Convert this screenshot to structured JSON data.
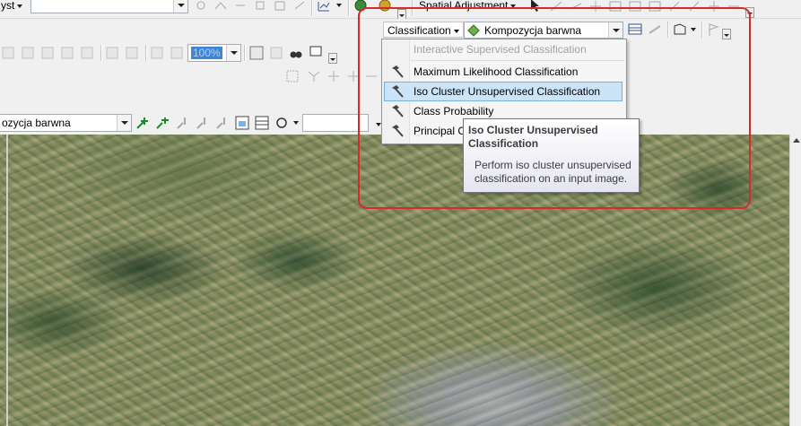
{
  "toolbar_top": {
    "left_combo": "yst",
    "spatial_adjustment_label": "Spatial Adjustment"
  },
  "toolbar_mid": {
    "zoom_value": "100%"
  },
  "toolbar_layer": {
    "layer_combo": "ozycja barwna"
  },
  "classification_toolbar": {
    "menu_label": "Classification",
    "layer_combo": "Kompozycja barwna"
  },
  "menu": {
    "items": [
      {
        "label": "Interactive Supervised Classification",
        "disabled": true,
        "icon": "none"
      },
      {
        "label": "Maximum Likelihood Classification",
        "disabled": false,
        "icon": "hammer-icon"
      },
      {
        "label": "Iso Cluster Unsupervised Classification",
        "disabled": false,
        "selected": true,
        "icon": "hammer-icon"
      },
      {
        "label": "Class Probability",
        "disabled": false,
        "icon": "hammer-icon"
      },
      {
        "label": "Principal Components",
        "disabled": false,
        "icon": "hammer-icon"
      }
    ]
  },
  "tooltip": {
    "title": "Iso Cluster Unsupervised Classification",
    "description": "Perform iso cluster unsupervised classification on an input image."
  },
  "colors": {
    "highlight": "#d62b2b",
    "selection": "#cce4f7"
  }
}
